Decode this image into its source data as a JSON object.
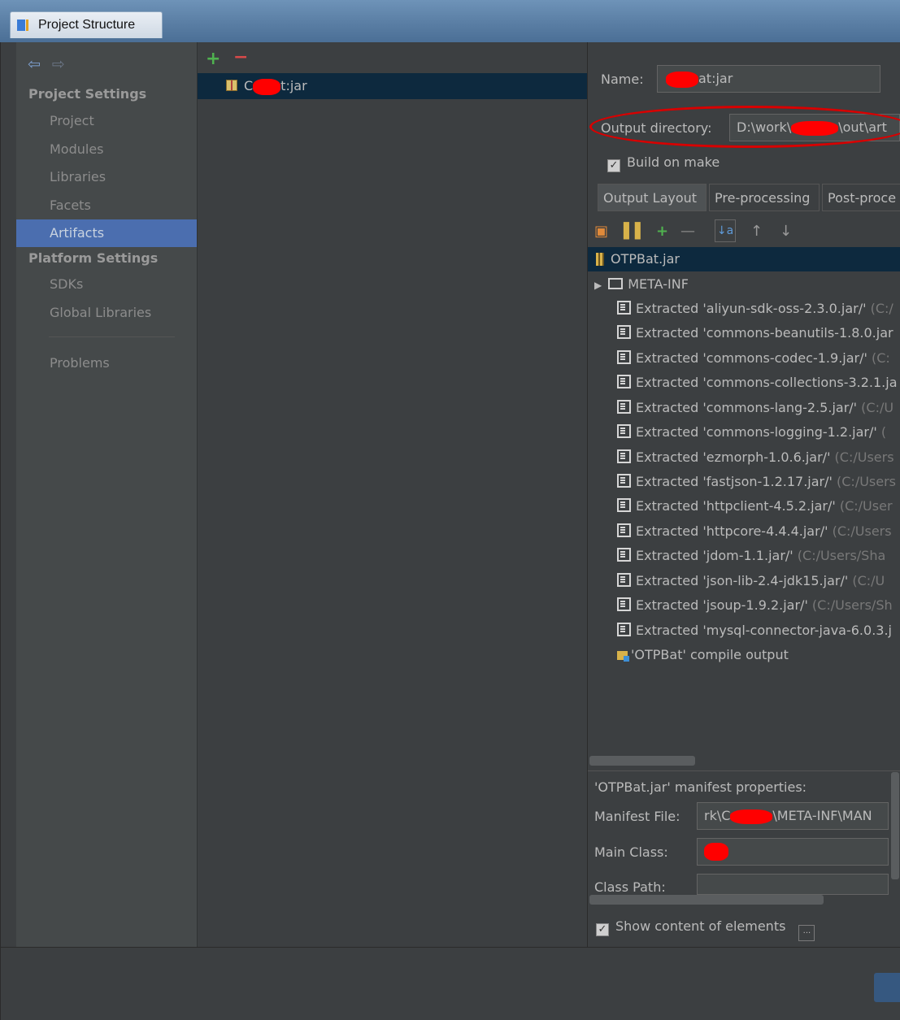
{
  "window": {
    "title": "Project Structure"
  },
  "sidebar": {
    "project_settings_header": "Project Settings",
    "platform_settings_header": "Platform Settings",
    "items": [
      {
        "label": "Project"
      },
      {
        "label": "Modules"
      },
      {
        "label": "Libraries"
      },
      {
        "label": "Facets"
      },
      {
        "label": "Artifacts"
      },
      {
        "label": "SDKs"
      },
      {
        "label": "Global Libraries"
      },
      {
        "label": "Problems"
      }
    ],
    "selected": "Artifacts"
  },
  "artifacts_list": {
    "add": "+",
    "remove": "−",
    "item_prefix": "C",
    "item_suffix": "t:jar"
  },
  "details": {
    "name_label": "Name:",
    "name_prefix": "",
    "name_suffix": "at:jar",
    "output_dir_label": "Output directory:",
    "output_dir_prefix": "D:\\work\\",
    "output_dir_suffix": "\\out\\art",
    "build_on_make": "Build on make",
    "tabs": [
      "Output Layout",
      "Pre-processing",
      "Post-proce"
    ],
    "active_tab": "Output Layout"
  },
  "layout_tree": {
    "root": "OTPBat.jar",
    "meta_inf": "META-INF",
    "rows": [
      {
        "name": "Extracted 'aliyun-sdk-oss-2.3.0.jar/'",
        "path": " (C:/"
      },
      {
        "name": "Extracted 'commons-beanutils-1.8.0.jar",
        "path": ""
      },
      {
        "name": "Extracted 'commons-codec-1.9.jar/'",
        "path": " (C:"
      },
      {
        "name": "Extracted 'commons-collections-3.2.1.ja",
        "path": ""
      },
      {
        "name": "Extracted 'commons-lang-2.5.jar/'",
        "path": " (C:/U"
      },
      {
        "name": "Extracted 'commons-logging-1.2.jar/'",
        "path": " ("
      },
      {
        "name": "Extracted 'ezmorph-1.0.6.jar/'",
        "path": " (C:/Users"
      },
      {
        "name": "Extracted 'fastjson-1.2.17.jar/'",
        "path": " (C:/Users"
      },
      {
        "name": "Extracted 'httpclient-4.5.2.jar/'",
        "path": " (C:/User"
      },
      {
        "name": "Extracted 'httpcore-4.4.4.jar/'",
        "path": " (C:/Users"
      },
      {
        "name": "Extracted 'jdom-1.1.jar/'",
        "path": " (C:/Users/Sha"
      },
      {
        "name": "Extracted 'json-lib-2.4-jdk15.jar/'",
        "path": " (C:/U"
      },
      {
        "name": "Extracted 'jsoup-1.9.2.jar/'",
        "path": " (C:/Users/Sh"
      },
      {
        "name": "Extracted 'mysql-connector-java-6.0.3.j",
        "path": ""
      }
    ],
    "compile_output": "'OTPBat' compile output"
  },
  "manifest": {
    "header": "'OTPBat.jar' manifest properties:",
    "file_label": "Manifest File:",
    "file_prefix": "rk\\C",
    "file_suffix": "\\META-INF\\MAN",
    "main_class_label": "Main Class:",
    "class_path_label": "Class Path:"
  },
  "show_content": "Show content of elements",
  "more_button": "..."
}
